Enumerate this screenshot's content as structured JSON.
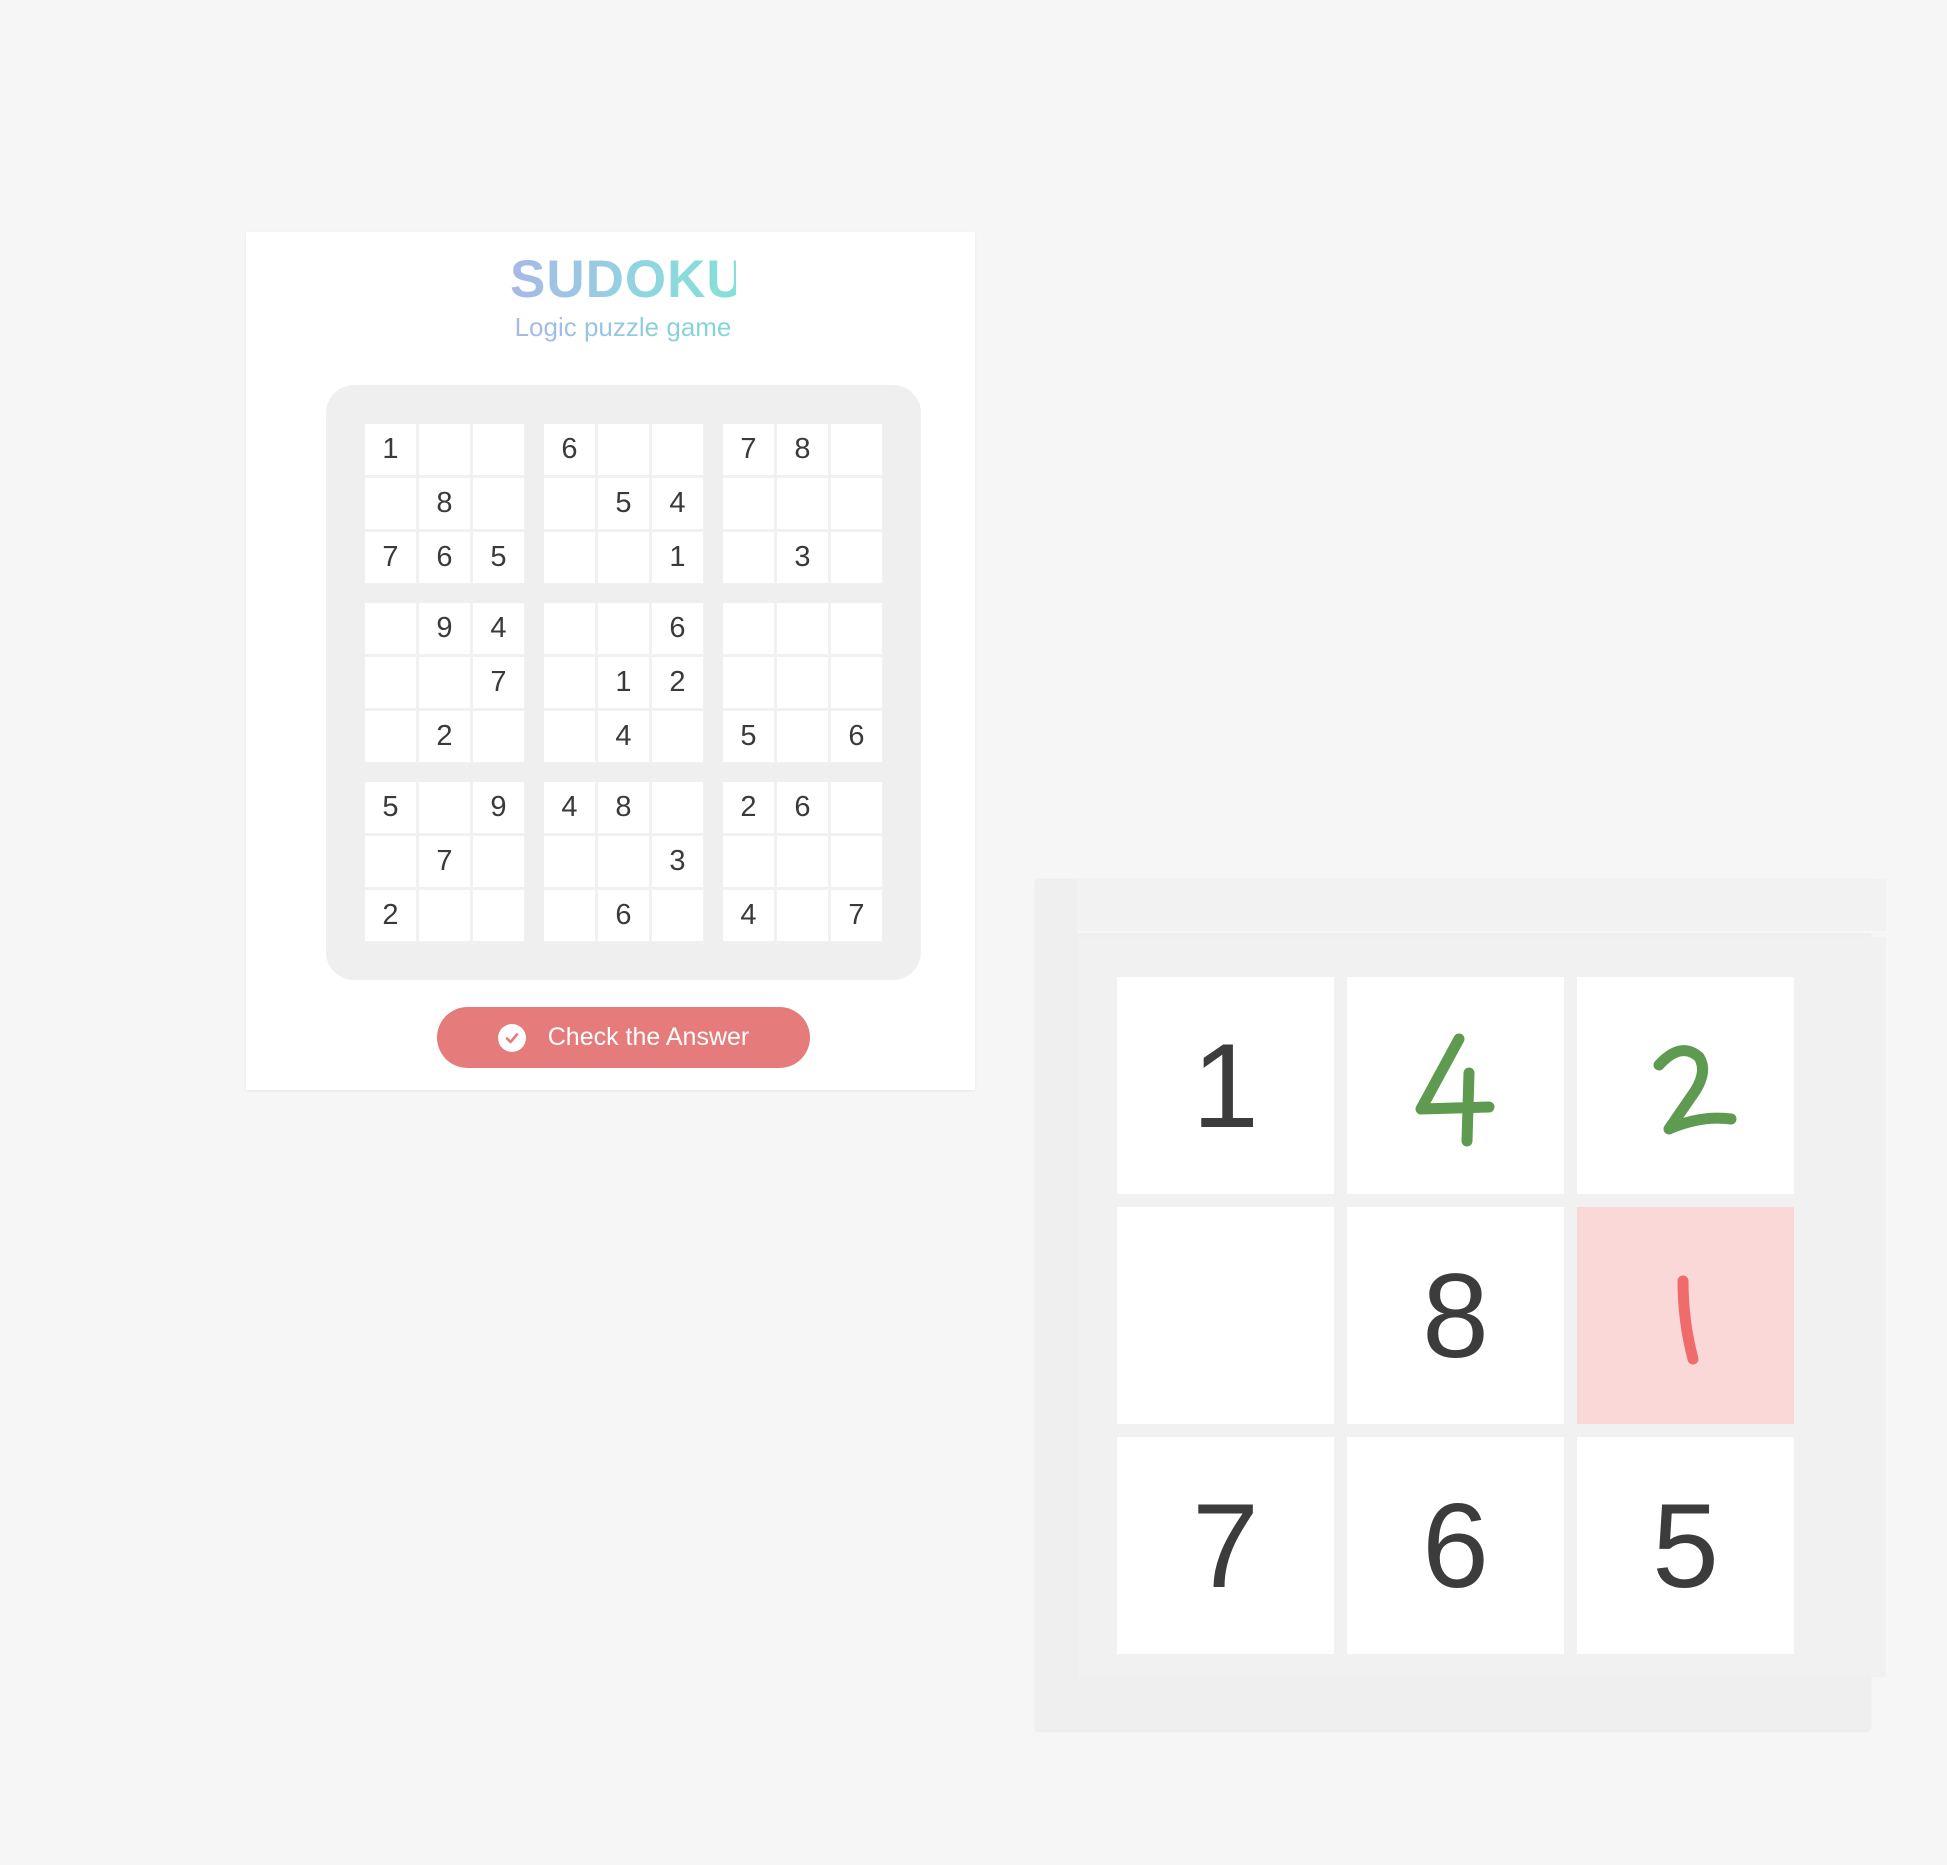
{
  "header": {
    "title": "SUDOKU",
    "subtitle": "Logic puzzle game"
  },
  "board": {
    "rows": [
      [
        "1",
        "",
        "",
        "6",
        "",
        "",
        "7",
        "8",
        ""
      ],
      [
        "",
        "8",
        "",
        "",
        "5",
        "4",
        "",
        "",
        ""
      ],
      [
        "7",
        "6",
        "5",
        "",
        "",
        "1",
        "",
        "3",
        ""
      ],
      [
        "",
        "9",
        "4",
        "",
        "",
        "6",
        "",
        "",
        ""
      ],
      [
        "",
        "",
        "7",
        "",
        "1",
        "2",
        "",
        "",
        ""
      ],
      [
        "",
        "2",
        "",
        "",
        "4",
        "",
        "5",
        "",
        "6"
      ],
      [
        "5",
        "",
        "9",
        "4",
        "8",
        "",
        "2",
        "6",
        ""
      ],
      [
        "",
        "7",
        "",
        "",
        "",
        "3",
        "",
        "",
        ""
      ],
      [
        "2",
        "",
        "",
        "",
        "6",
        "",
        "4",
        "",
        "7"
      ]
    ]
  },
  "check_button": {
    "label": "Check the Answer",
    "icon": "check-circle-icon"
  },
  "zoom_inset": {
    "cells": [
      {
        "value": "1",
        "kind": "given"
      },
      {
        "value": "4",
        "kind": "handwritten-correct"
      },
      {
        "value": "2",
        "kind": "handwritten-correct"
      },
      {
        "value": "",
        "kind": "empty"
      },
      {
        "value": "8",
        "kind": "given"
      },
      {
        "value": "1",
        "kind": "handwritten-error"
      },
      {
        "value": "7",
        "kind": "given"
      },
      {
        "value": "6",
        "kind": "given"
      },
      {
        "value": "5",
        "kind": "given"
      }
    ],
    "colors": {
      "correct": "#5e9a4f",
      "error": "#f06b6b",
      "error_bg": "#fbd8d8"
    }
  }
}
